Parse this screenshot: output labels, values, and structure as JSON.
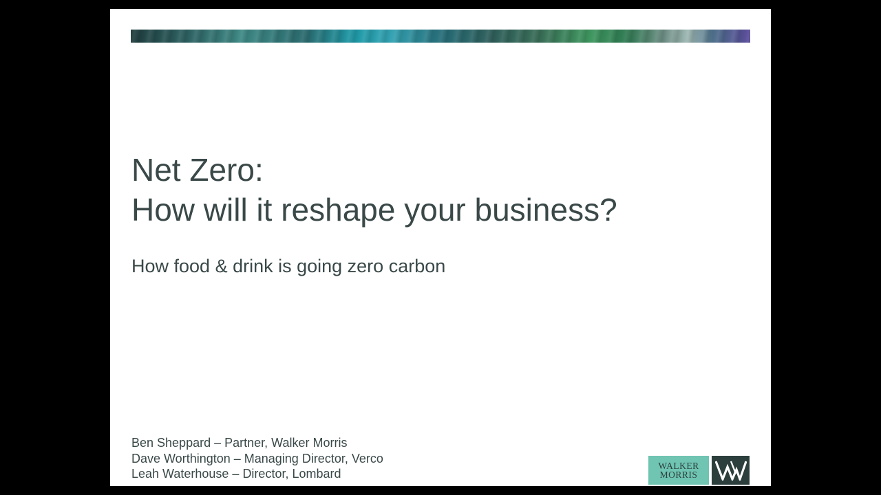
{
  "slide": {
    "title_lines": [
      "Net Zero:",
      "How will it reshape your business?"
    ],
    "subtitle": "How food & drink is going zero carbon",
    "speakers": [
      "Ben Sheppard – Partner, Walker Morris",
      "Dave Worthington – Managing Director, Verco",
      "Leah Waterhouse – Director, Lombard"
    ]
  },
  "logo": {
    "word_lines": [
      "WALKER",
      "MORRIS"
    ],
    "mark_icon": "wm-monogram-icon"
  },
  "colors": {
    "background": "#000000",
    "slide": "#ffffff",
    "text": "#3a4848",
    "logo_green": "#6fc4b2",
    "logo_dark": "#2c3f3c"
  }
}
